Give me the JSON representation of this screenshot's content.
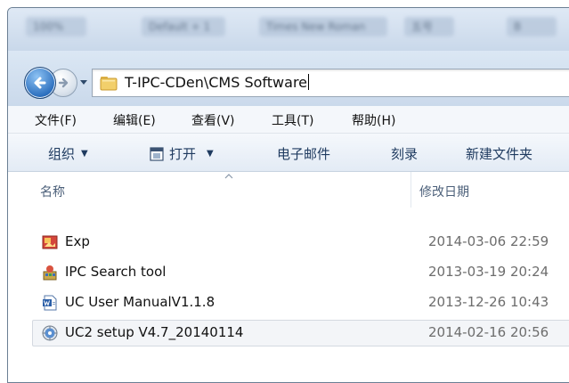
{
  "background_tabs": [
    "100%",
    "Default + 1",
    "Times New Roman",
    "五号",
    "B"
  ],
  "address": {
    "path": "T-IPC-CDen\\CMS Software"
  },
  "menu": [
    "文件(F)",
    "编辑(E)",
    "查看(V)",
    "工具(T)",
    "帮助(H)"
  ],
  "toolbar": {
    "organize": "组织",
    "open": "打开",
    "email": "电子邮件",
    "burn": "刻录",
    "new_folder": "新建文件夹"
  },
  "columns": {
    "name": "名称",
    "date": "修改日期"
  },
  "files": [
    {
      "name": "Exp",
      "date": "2014-03-06 22:59",
      "icon": "image-file-icon"
    },
    {
      "name": "IPC Search tool",
      "date": "2013-03-19 20:24",
      "icon": "application-icon"
    },
    {
      "name": "UC User ManualV1.1.8",
      "date": "2013-12-26 10:43",
      "icon": "word-document-icon"
    },
    {
      "name": "UC2 setup V4.7_20140114",
      "date": "2014-02-16 20:56",
      "icon": "setup-icon",
      "selected": true
    }
  ],
  "colors": {
    "accent_blue": "#2c6fbe",
    "toolbar_text": "#1e3a5f",
    "date_text": "#6d6d6d",
    "header_text": "#4c607a"
  }
}
